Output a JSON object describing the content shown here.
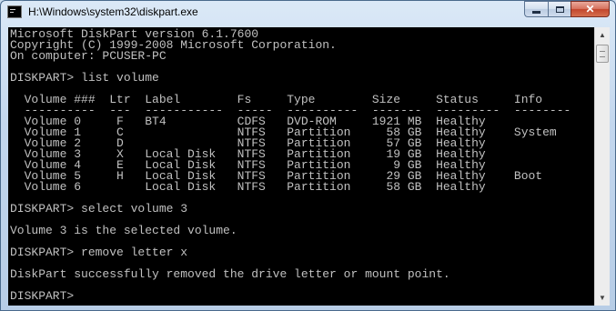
{
  "window": {
    "title": "H:\\Windows\\system32\\diskpart.exe",
    "icon": "console-icon",
    "controls": {
      "minimize": "minimize-icon",
      "maximize": "maximize-icon",
      "close": "close-icon",
      "close_glyph": "✕"
    }
  },
  "console": {
    "lines": [
      "Microsoft DiskPart version 6.1.7600",
      "Copyright (C) 1999-2008 Microsoft Corporation.",
      "On computer: PCUSER-PC",
      "",
      "DISKPART> list volume",
      "",
      "  Volume ###  Ltr  Label        Fs     Type        Size     Status     Info",
      "  ----------  ---  -----------  -----  ----------  -------  ---------  --------",
      "  Volume 0     F   BT4          CDFS   DVD-ROM     1921 MB  Healthy",
      "  Volume 1     C                NTFS   Partition     58 GB  Healthy    System",
      "  Volume 2     D                NTFS   Partition     57 GB  Healthy",
      "  Volume 3     X   Local Disk   NTFS   Partition     19 GB  Healthy",
      "  Volume 4     E   Local Disk   NTFS   Partition      9 GB  Healthy",
      "  Volume 5     H   Local Disk   NTFS   Partition     29 GB  Healthy    Boot",
      "  Volume 6         Local Disk   NTFS   Partition     58 GB  Healthy",
      "",
      "DISKPART> select volume 3",
      "",
      "Volume 3 is the selected volume.",
      "",
      "DISKPART> remove letter x",
      "",
      "DiskPart successfully removed the drive letter or mount point.",
      "",
      "DISKPART> "
    ]
  },
  "scrollbar": {
    "up": "▲",
    "down": "▼"
  },
  "colors": {
    "console_bg": "#000000",
    "console_fg": "#c0c0c0"
  }
}
